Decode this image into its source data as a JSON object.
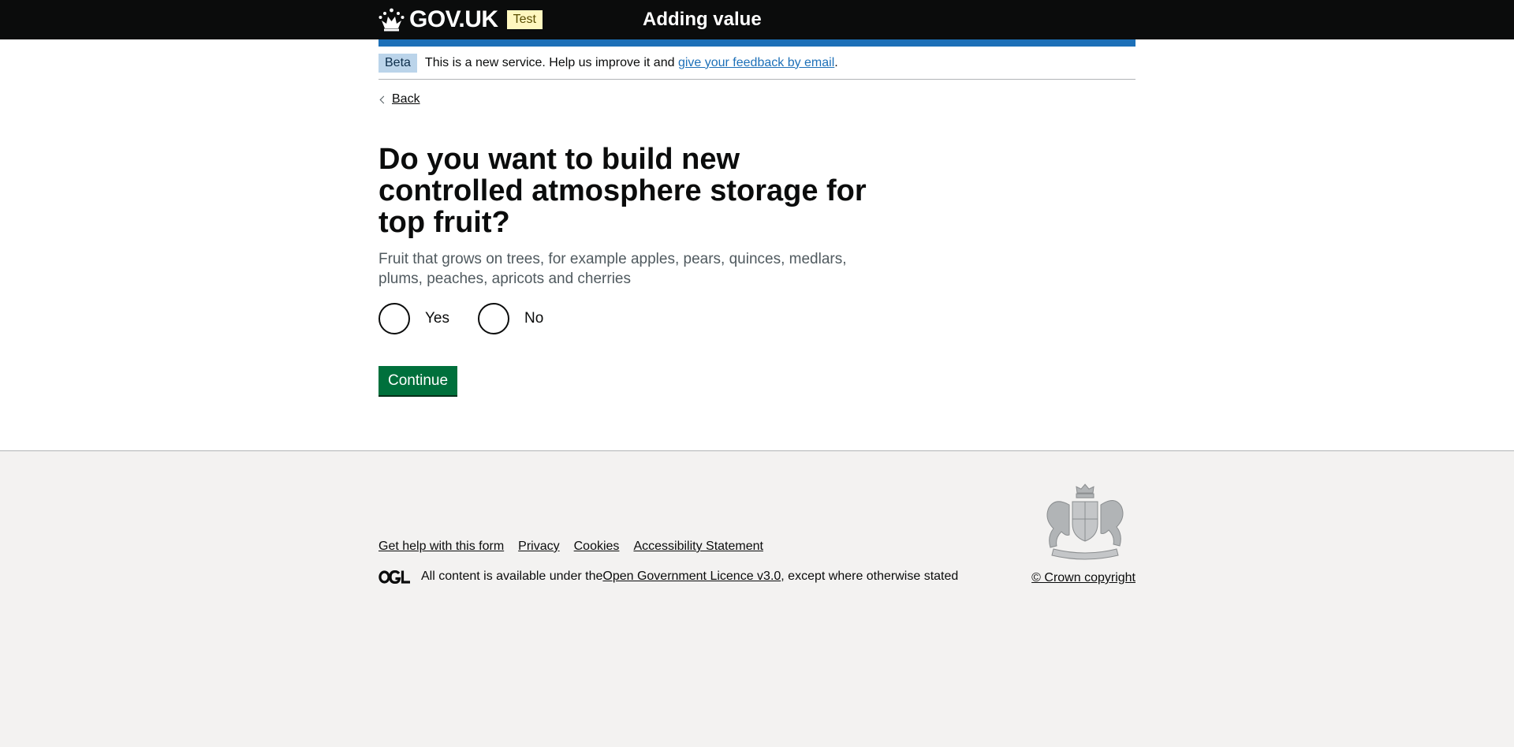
{
  "header": {
    "logo_text": "GOV.UK",
    "env_tag": "Test",
    "service_name": "Adding value"
  },
  "phase_banner": {
    "tag": "Beta",
    "text_before": "This is a new service. Help us improve it and ",
    "link_text": "give your feedback by email",
    "text_after": "."
  },
  "back_link": "Back",
  "question": {
    "title": "Do you want to build new controlled atmosphere storage for top fruit?",
    "hint": "Fruit that grows on trees, for example apples, pears, quinces, medlars, plums, peaches, apricots and cherries",
    "options": [
      "Yes",
      "No"
    ]
  },
  "continue_button": "Continue",
  "footer": {
    "links": [
      "Get help with this form",
      "Privacy",
      "Cookies",
      "Accessibility Statement"
    ],
    "licence_before": "All content is available under the ",
    "licence_link": "Open Government Licence v3.0",
    "licence_after": ", except where otherwise stated",
    "copyright": "© Crown copyright"
  },
  "colors": {
    "header_bg": "#0b0c0c",
    "accent_blue": "#1d70b8",
    "button_green": "#00703c",
    "footer_bg": "#f3f2f1"
  }
}
